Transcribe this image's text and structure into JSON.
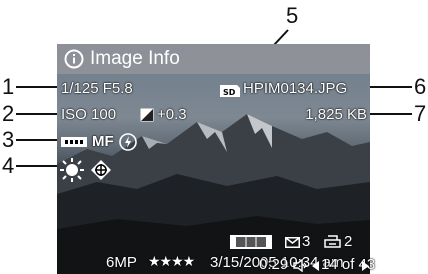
{
  "title": "Image Info",
  "exposure": "1/125 F5.8",
  "iso": "ISO 100",
  "ev_comp": "+0.3",
  "focus_mode": "MF",
  "filename": "HPIM0134.JPG",
  "filesize": "1,825 KB",
  "email_count": "3",
  "print_count": "2",
  "resolution": "6MP",
  "quality_stars": "★★★★",
  "datetime": "3/15/2005 10:34 am",
  "duration": "0:29",
  "position": "14 of 43",
  "callouts": {
    "c1": "1",
    "c2": "2",
    "c3": "3",
    "c4": "4",
    "c5": "5",
    "c6": "6",
    "c7": "7"
  },
  "icons": {
    "info": "info-icon",
    "sd_card": "sd-card-icon",
    "ev": "exposure-compensation-icon",
    "focus_range": "focus-range-icon",
    "flash_off": "flash-off-icon",
    "white_balance": "sun-icon",
    "ae_metering": "metering-icon",
    "panorama": "panorama-icon",
    "email": "envelope-icon",
    "print": "print-icon",
    "audio": "speaker-icon",
    "prev": "prev-arrow-icon",
    "next": "next-arrow-icon"
  },
  "colors": {
    "overlay_text": "#ffffff",
    "title_bar": "#9a9a9f"
  }
}
